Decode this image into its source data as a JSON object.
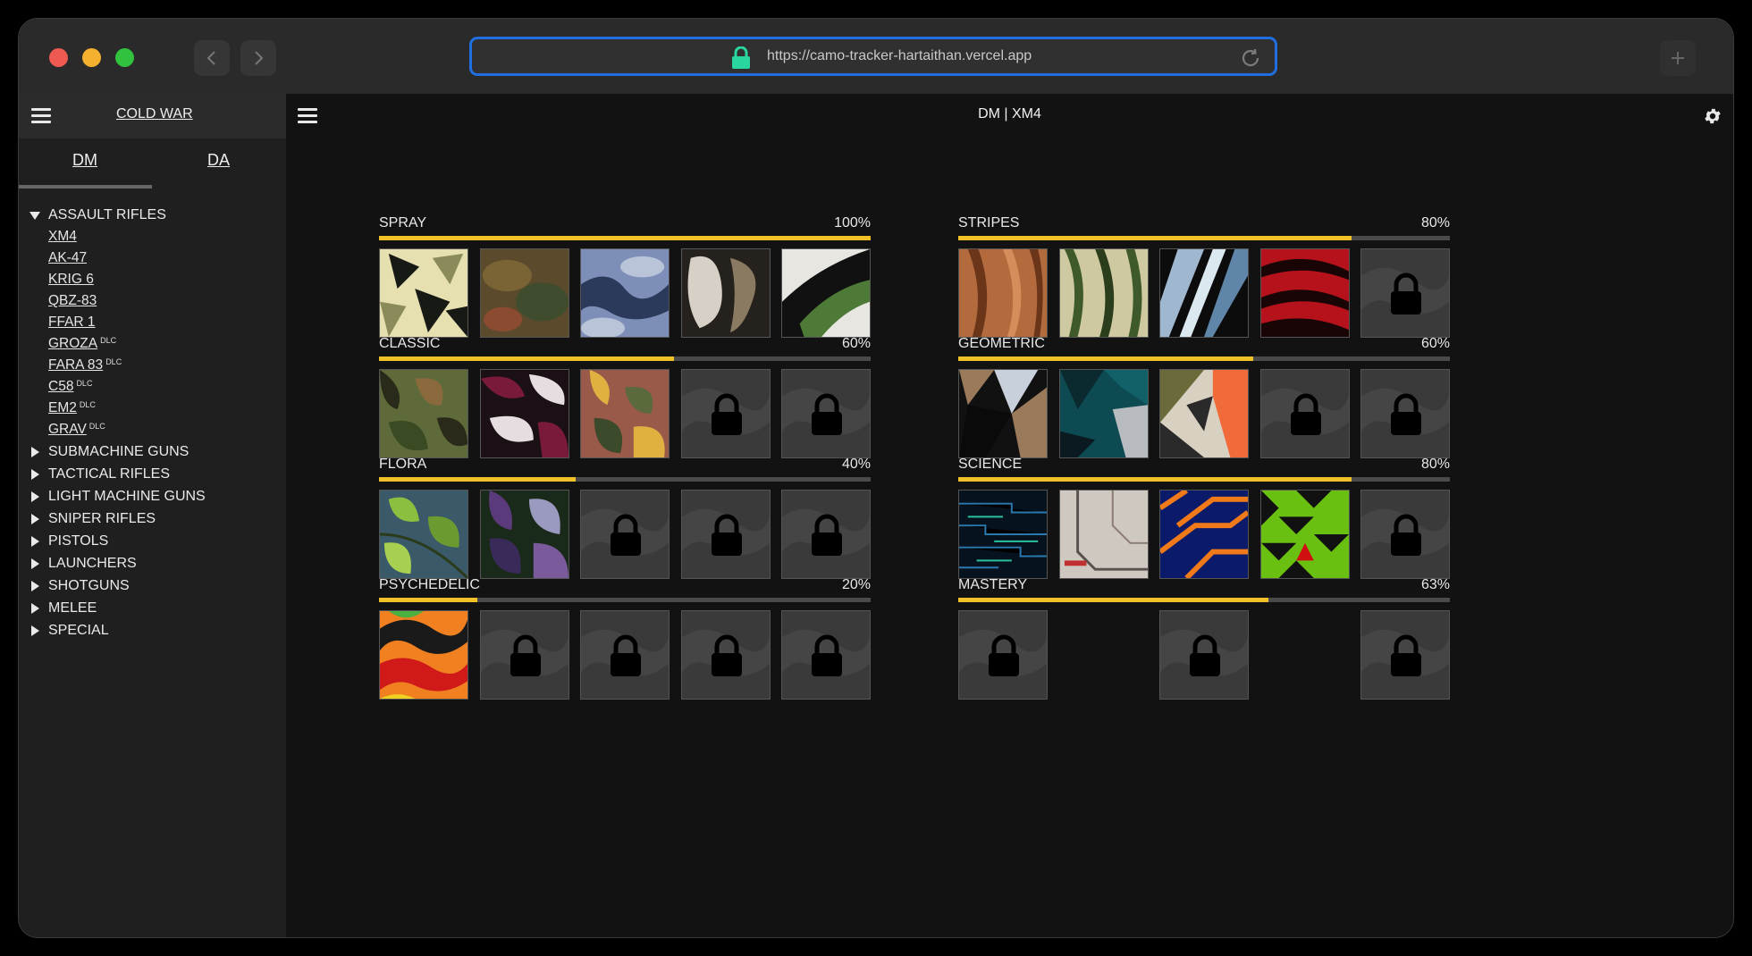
{
  "browser": {
    "url": "https://camo-tracker-hartaithan.vercel.app"
  },
  "sidebar": {
    "game_title": "COLD WAR",
    "tabs": [
      {
        "label": "DM"
      },
      {
        "label": "DA"
      }
    ],
    "categories": [
      {
        "label": "ASSAULT RIFLES",
        "expanded": true
      },
      {
        "label": "SUBMACHINE GUNS",
        "expanded": false
      },
      {
        "label": "TACTICAL RIFLES",
        "expanded": false
      },
      {
        "label": "LIGHT MACHINE GUNS",
        "expanded": false
      },
      {
        "label": "SNIPER RIFLES",
        "expanded": false
      },
      {
        "label": "PISTOLS",
        "expanded": false
      },
      {
        "label": "LAUNCHERS",
        "expanded": false
      },
      {
        "label": "SHOTGUNS",
        "expanded": false
      },
      {
        "label": "MELEE",
        "expanded": false
      },
      {
        "label": "SPECIAL",
        "expanded": false
      }
    ],
    "weapons": [
      {
        "name": "XM4",
        "dlc": ""
      },
      {
        "name": "AK-47",
        "dlc": ""
      },
      {
        "name": "KRIG 6",
        "dlc": ""
      },
      {
        "name": "QBZ-83",
        "dlc": ""
      },
      {
        "name": "FFAR 1",
        "dlc": ""
      },
      {
        "name": "GROZA",
        "dlc": "DLC"
      },
      {
        "name": "FARA 83",
        "dlc": "DLC"
      },
      {
        "name": "C58",
        "dlc": "DLC"
      },
      {
        "name": "EM2",
        "dlc": "DLC"
      },
      {
        "name": "GRAV",
        "dlc": "DLC"
      }
    ]
  },
  "main": {
    "title": "DM | XM4",
    "accent_color": "#f2c027",
    "groups": [
      {
        "name": "SPRAY",
        "percent": "100%",
        "progress": 1.0,
        "tiles": [
          {
            "pattern": "spray1",
            "locked": false
          },
          {
            "pattern": "spray2",
            "locked": false
          },
          {
            "pattern": "spray3",
            "locked": false
          },
          {
            "pattern": "spray4",
            "locked": false
          },
          {
            "pattern": "spray5",
            "locked": false
          }
        ]
      },
      {
        "name": "STRIPES",
        "percent": "80%",
        "progress": 0.8,
        "tiles": [
          {
            "pattern": "stripe1",
            "locked": false
          },
          {
            "pattern": "stripe2",
            "locked": false
          },
          {
            "pattern": "stripe3",
            "locked": false
          },
          {
            "pattern": "stripe4",
            "locked": false
          },
          {
            "pattern": "grey",
            "locked": true
          }
        ]
      },
      {
        "name": "CLASSIC",
        "percent": "60%",
        "progress": 0.6,
        "tiles": [
          {
            "pattern": "classic1",
            "locked": false
          },
          {
            "pattern": "classic2",
            "locked": false
          },
          {
            "pattern": "classic3",
            "locked": false
          },
          {
            "pattern": "grey",
            "locked": true
          },
          {
            "pattern": "grey",
            "locked": true
          }
        ]
      },
      {
        "name": "GEOMETRIC",
        "percent": "60%",
        "progress": 0.6,
        "tiles": [
          {
            "pattern": "geo1",
            "locked": false
          },
          {
            "pattern": "geo2",
            "locked": false
          },
          {
            "pattern": "geo3",
            "locked": false
          },
          {
            "pattern": "grey",
            "locked": true
          },
          {
            "pattern": "grey",
            "locked": true
          }
        ]
      },
      {
        "name": "FLORA",
        "percent": "40%",
        "progress": 0.4,
        "tiles": [
          {
            "pattern": "flora1",
            "locked": false
          },
          {
            "pattern": "flora2",
            "locked": false
          },
          {
            "pattern": "grey",
            "locked": true
          },
          {
            "pattern": "grey",
            "locked": true
          },
          {
            "pattern": "grey",
            "locked": true
          }
        ]
      },
      {
        "name": "SCIENCE",
        "percent": "80%",
        "progress": 0.8,
        "tiles": [
          {
            "pattern": "sci1",
            "locked": false
          },
          {
            "pattern": "sci2",
            "locked": false
          },
          {
            "pattern": "sci3",
            "locked": false
          },
          {
            "pattern": "sci4",
            "locked": false
          },
          {
            "pattern": "grey",
            "locked": true
          }
        ]
      },
      {
        "name": "PSYCHEDELIC",
        "percent": "20%",
        "progress": 0.2,
        "tiles": [
          {
            "pattern": "psy1",
            "locked": false
          },
          {
            "pattern": "grey",
            "locked": true
          },
          {
            "pattern": "grey",
            "locked": true
          },
          {
            "pattern": "grey",
            "locked": true
          },
          {
            "pattern": "grey",
            "locked": true
          }
        ]
      },
      {
        "name": "MASTERY",
        "percent": "63%",
        "progress": 0.63,
        "tiles": [
          {
            "pattern": "grey",
            "locked": true
          },
          {
            "pattern": "empty",
            "locked": false
          },
          {
            "pattern": "grey",
            "locked": true
          },
          {
            "pattern": "empty",
            "locked": false
          },
          {
            "pattern": "grey",
            "locked": true
          }
        ]
      }
    ]
  }
}
